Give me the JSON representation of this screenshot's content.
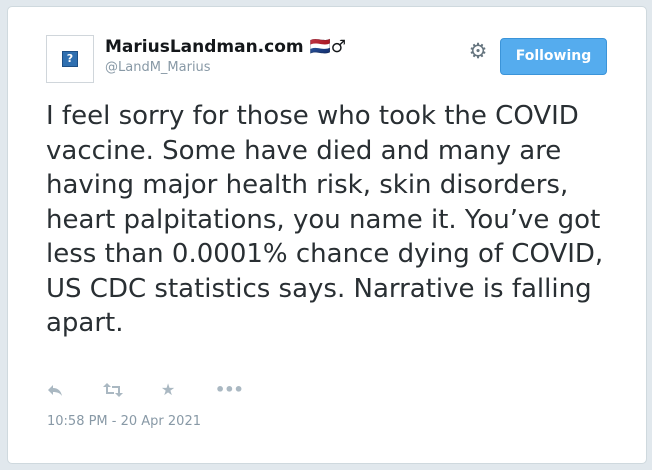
{
  "tweet": {
    "author": {
      "display_name": "MariusLandman.com 🇳🇱♂",
      "handle": "@LandM_Marius",
      "avatar_icon": "broken-image-icon"
    },
    "follow_button_label": "Following",
    "text": "I feel sorry for those who took the COVID vaccine. Some have died and many are having major health risk, skin disorders, heart palpitations, you name it. You’ve got less than 0.0001% chance dying of COVID, US CDC statistics says. Narrative is falling apart.",
    "timestamp": "10:58 PM - 20 Apr 2021",
    "actions": [
      "reply-icon",
      "retweet-icon",
      "favorite-icon",
      "more-icon"
    ]
  },
  "colors": {
    "accent": "#55acee",
    "text": "#292f33",
    "muted": "#8899a6"
  }
}
